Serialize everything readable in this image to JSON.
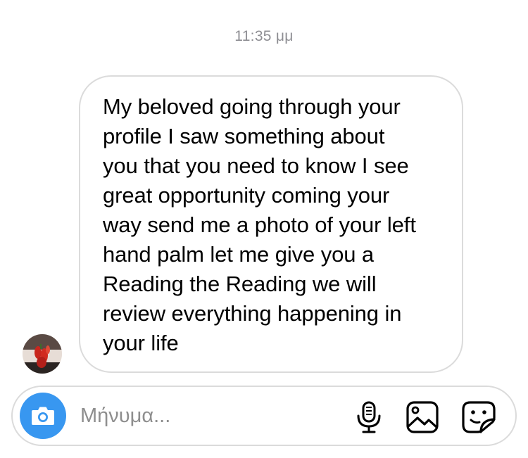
{
  "thread": {
    "timestamp": "11:35 μμ"
  },
  "message": {
    "text": "My beloved going through your\nprofile I saw something about\nyou that you need to know I see\ngreat opportunity coming your\nway send me a photo of your left\nhand palm let me give you a\nReading the Reading we will\nreview everything happening in\nyour life"
  },
  "sender": {
    "avatar_icon": "profile-photo-avatar"
  },
  "composer": {
    "placeholder": "Μήνυμα...",
    "value": "",
    "camera_icon": "camera-icon",
    "mic_icon": "microphone-icon",
    "gallery_icon": "image-gallery-icon",
    "sticker_icon": "sticker-icon"
  },
  "colors": {
    "accent": "#3897f0",
    "timestamp": "#8e8e93",
    "border": "#dbdbdb",
    "placeholder": "#8e8e8e"
  }
}
